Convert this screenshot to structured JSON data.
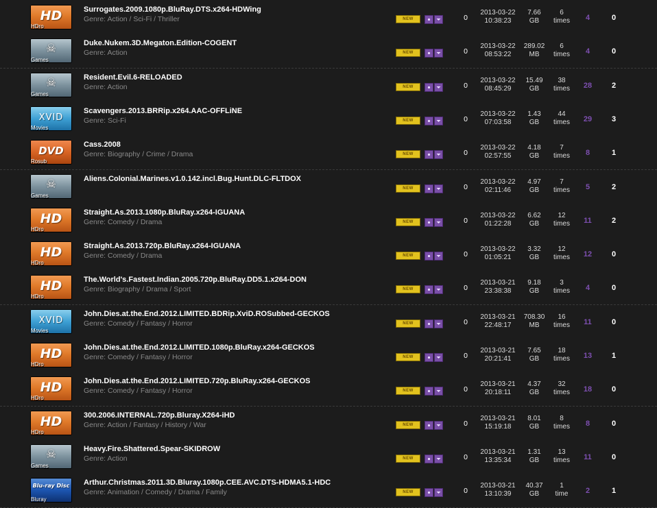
{
  "badge_new": "NEW",
  "colors": {
    "background": "#1c1c1c",
    "title": "#ffffff",
    "genre": "#8a8a8a",
    "seeders": "#7d4fb0",
    "new_badge": "#e2c21e",
    "action_buttons": "#7a4fa8"
  },
  "torrents": [
    {
      "category": "HDro",
      "cat_type": "hd",
      "cat_icon": "HD",
      "name": "Surrogates.2009.1080p.BluRay.DTS.x264-HDWing",
      "genre": "Genre: Action / Sci-Fi / Thriller",
      "comments": "0",
      "date": "2013-03-22",
      "time": "10:38:23",
      "size_val": "7.66",
      "size_unit": "GB",
      "snatched": "6",
      "snatched_unit": "times",
      "seeders": "4",
      "leechers": "0"
    },
    {
      "category": "Games",
      "cat_type": "games",
      "cat_icon": "☠",
      "name": "Duke.Nukem.3D.Megaton.Edition-COGENT",
      "genre": "Genre: Action",
      "comments": "0",
      "date": "2013-03-22",
      "time": "08:53:22",
      "size_val": "289.02",
      "size_unit": "MB",
      "snatched": "6",
      "snatched_unit": "times",
      "seeders": "4",
      "leechers": "0"
    },
    {
      "category": "Games",
      "cat_type": "games",
      "cat_icon": "☠",
      "name": "Resident.Evil.6-RELOADED",
      "genre": "Genre: Action",
      "comments": "0",
      "date": "2013-03-22",
      "time": "08:45:29",
      "size_val": "15.49",
      "size_unit": "GB",
      "snatched": "38",
      "snatched_unit": "times",
      "seeders": "28",
      "leechers": "2"
    },
    {
      "category": "Movies",
      "cat_type": "movies",
      "cat_icon": "XVID",
      "name": "Scavengers.2013.BRRip.x264.AAC-OFFLiNE",
      "genre": "Genre: Sci-Fi",
      "comments": "0",
      "date": "2013-03-22",
      "time": "07:03:58",
      "size_val": "1.43",
      "size_unit": "GB",
      "snatched": "44",
      "snatched_unit": "times",
      "seeders": "29",
      "leechers": "3"
    },
    {
      "category": "Rosub",
      "cat_type": "dvd",
      "cat_icon": "DVD",
      "name": "Cass.2008",
      "genre": "Genre: Biography / Crime / Drama",
      "comments": "0",
      "date": "2013-03-22",
      "time": "02:57:55",
      "size_val": "4.18",
      "size_unit": "GB",
      "snatched": "7",
      "snatched_unit": "times",
      "seeders": "8",
      "leechers": "1"
    },
    {
      "category": "Games",
      "cat_type": "games",
      "cat_icon": "☠",
      "name": "Aliens.Colonial.Marines.v1.0.142.incl.Bug.Hunt.DLC-FLTDOX",
      "genre": "",
      "comments": "0",
      "date": "2013-03-22",
      "time": "02:11:46",
      "size_val": "4.97",
      "size_unit": "GB",
      "snatched": "7",
      "snatched_unit": "times",
      "seeders": "5",
      "leechers": "2"
    },
    {
      "category": "HDro",
      "cat_type": "hd",
      "cat_icon": "HD",
      "name": "Straight.As.2013.1080p.BluRay.x264-IGUANA",
      "genre": "Genre: Comedy / Drama",
      "comments": "0",
      "date": "2013-03-22",
      "time": "01:22:28",
      "size_val": "6.62",
      "size_unit": "GB",
      "snatched": "12",
      "snatched_unit": "times",
      "seeders": "11",
      "leechers": "2"
    },
    {
      "category": "HDro",
      "cat_type": "hd",
      "cat_icon": "HD",
      "name": "Straight.As.2013.720p.BluRay.x264-IGUANA",
      "genre": "Genre: Comedy / Drama",
      "comments": "0",
      "date": "2013-03-22",
      "time": "01:05:21",
      "size_val": "3.32",
      "size_unit": "GB",
      "snatched": "12",
      "snatched_unit": "times",
      "seeders": "12",
      "leechers": "0"
    },
    {
      "category": "HDro",
      "cat_type": "hd",
      "cat_icon": "HD",
      "name": "The.World's.Fastest.Indian.2005.720p.BluRay.DD5.1.x264-DON",
      "genre": "Genre: Biography / Drama / Sport",
      "comments": "0",
      "date": "2013-03-21",
      "time": "23:38:38",
      "size_val": "9.18",
      "size_unit": "GB",
      "snatched": "3",
      "snatched_unit": "times",
      "seeders": "4",
      "leechers": "0"
    },
    {
      "category": "Movies",
      "cat_type": "movies",
      "cat_icon": "XVID",
      "name": "John.Dies.at.the.End.2012.LIMITED.BDRip.XviD.ROSubbed-GECKOS",
      "genre": "Genre: Comedy / Fantasy / Horror",
      "comments": "0",
      "date": "2013-03-21",
      "time": "22:48:17",
      "size_val": "708.30",
      "size_unit": "MB",
      "snatched": "16",
      "snatched_unit": "times",
      "seeders": "11",
      "leechers": "0"
    },
    {
      "category": "HDro",
      "cat_type": "hd",
      "cat_icon": "HD",
      "name": "John.Dies.at.the.End.2012.LIMITED.1080p.BluRay.x264-GECKOS",
      "genre": "Genre: Comedy / Fantasy / Horror",
      "comments": "0",
      "date": "2013-03-21",
      "time": "20:21:41",
      "size_val": "7.65",
      "size_unit": "GB",
      "snatched": "18",
      "snatched_unit": "times",
      "seeders": "13",
      "leechers": "1"
    },
    {
      "category": "HDro",
      "cat_type": "hd",
      "cat_icon": "HD",
      "name": "John.Dies.at.the.End.2012.LIMITED.720p.BluRay.x264-GECKOS",
      "genre": "Genre: Comedy / Fantasy / Horror",
      "comments": "0",
      "date": "2013-03-21",
      "time": "20:18:11",
      "size_val": "4.37",
      "size_unit": "GB",
      "snatched": "32",
      "snatched_unit": "times",
      "seeders": "18",
      "leechers": "0"
    },
    {
      "category": "HDro",
      "cat_type": "hd",
      "cat_icon": "HD",
      "name": "300.2006.INTERNAL.720p.Bluray.X264-iHD",
      "genre": "Genre: Action / Fantasy / History / War",
      "comments": "0",
      "date": "2013-03-21",
      "time": "15:19:18",
      "size_val": "8.01",
      "size_unit": "GB",
      "snatched": "8",
      "snatched_unit": "times",
      "seeders": "8",
      "leechers": "0"
    },
    {
      "category": "Games",
      "cat_type": "games",
      "cat_icon": "☠",
      "name": "Heavy.Fire.Shattered.Spear-SKIDROW",
      "genre": "Genre: Action",
      "comments": "0",
      "date": "2013-03-21",
      "time": "13:35:34",
      "size_val": "1.31",
      "size_unit": "GB",
      "snatched": "13",
      "snatched_unit": "times",
      "seeders": "11",
      "leechers": "0"
    },
    {
      "category": "Bluray",
      "cat_type": "bluray",
      "cat_icon": "Blu-ray Disc",
      "name": "Arthur.Christmas.2011.3D.Bluray.1080p.CEE.AVC.DTS-HDMA5.1-HDC",
      "genre": "Genre: Animation / Comedy / Drama / Family",
      "comments": "0",
      "date": "2013-03-21",
      "time": "13:10:39",
      "size_val": "40.37",
      "size_unit": "GB",
      "snatched": "1",
      "snatched_unit": "time",
      "seeders": "2",
      "leechers": "1"
    }
  ]
}
